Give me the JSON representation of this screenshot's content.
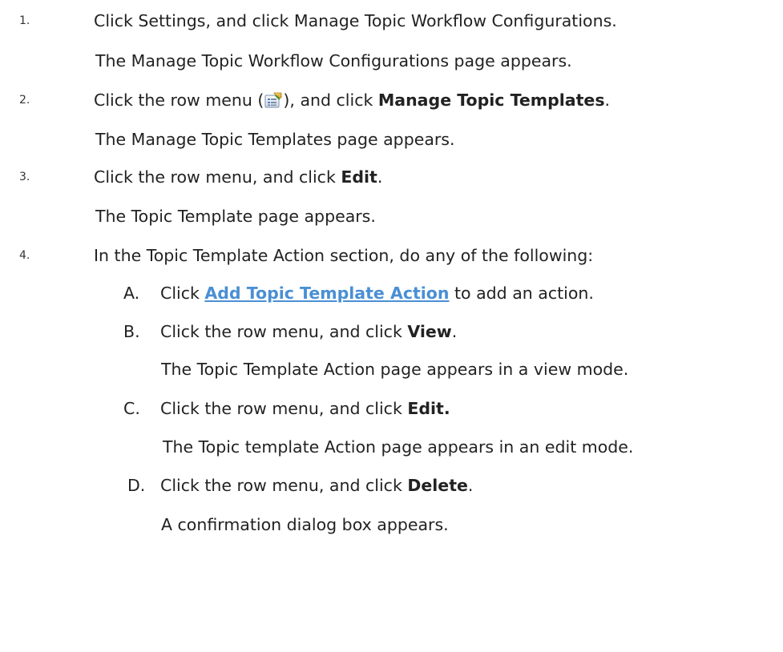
{
  "steps": [
    {
      "number": "1.",
      "instruction": "Click Settings, and click Manage Topic Workflow Configurations.",
      "result": "The Manage Topic Workflow Configurations page appears."
    },
    {
      "number": "2.",
      "instruction_pre": "Click the row menu (",
      "icon": "row-menu-icon",
      "instruction_mid": "), and click ",
      "instruction_bold": "Manage Topic Templates",
      "instruction_end": ".",
      "result": "The Manage Topic Templates page appears."
    },
    {
      "number": "3.",
      "instruction_pre": "Click the row menu, and click ",
      "instruction_bold": "Edit",
      "instruction_end": ".",
      "result": "The Topic Template page appears."
    },
    {
      "number": "4.",
      "instruction": "In the Topic Template Action section, do any of the following:",
      "substeps": [
        {
          "letter": "A.",
          "pre": "Click ",
          "link": "Add Topic Template Action",
          "post": " to add an action."
        },
        {
          "letter": "B.",
          "pre": "Click the row menu, and click ",
          "bold": "View",
          "post": ".",
          "result": "The Topic Template Action page appears in a view mode."
        },
        {
          "letter": "C.",
          "pre": "Click the row menu, and click ",
          "bold": "Edit.",
          "post": "",
          "result": "The Topic template Action page appears in an edit mode."
        },
        {
          "letter": "D.",
          "pre": "Click the row menu, and click ",
          "bold": "Delete",
          "post": ".",
          "result": "A confirmation dialog box appears."
        }
      ]
    }
  ],
  "colors": {
    "text": "#222222",
    "link": "#4a8fd4"
  }
}
